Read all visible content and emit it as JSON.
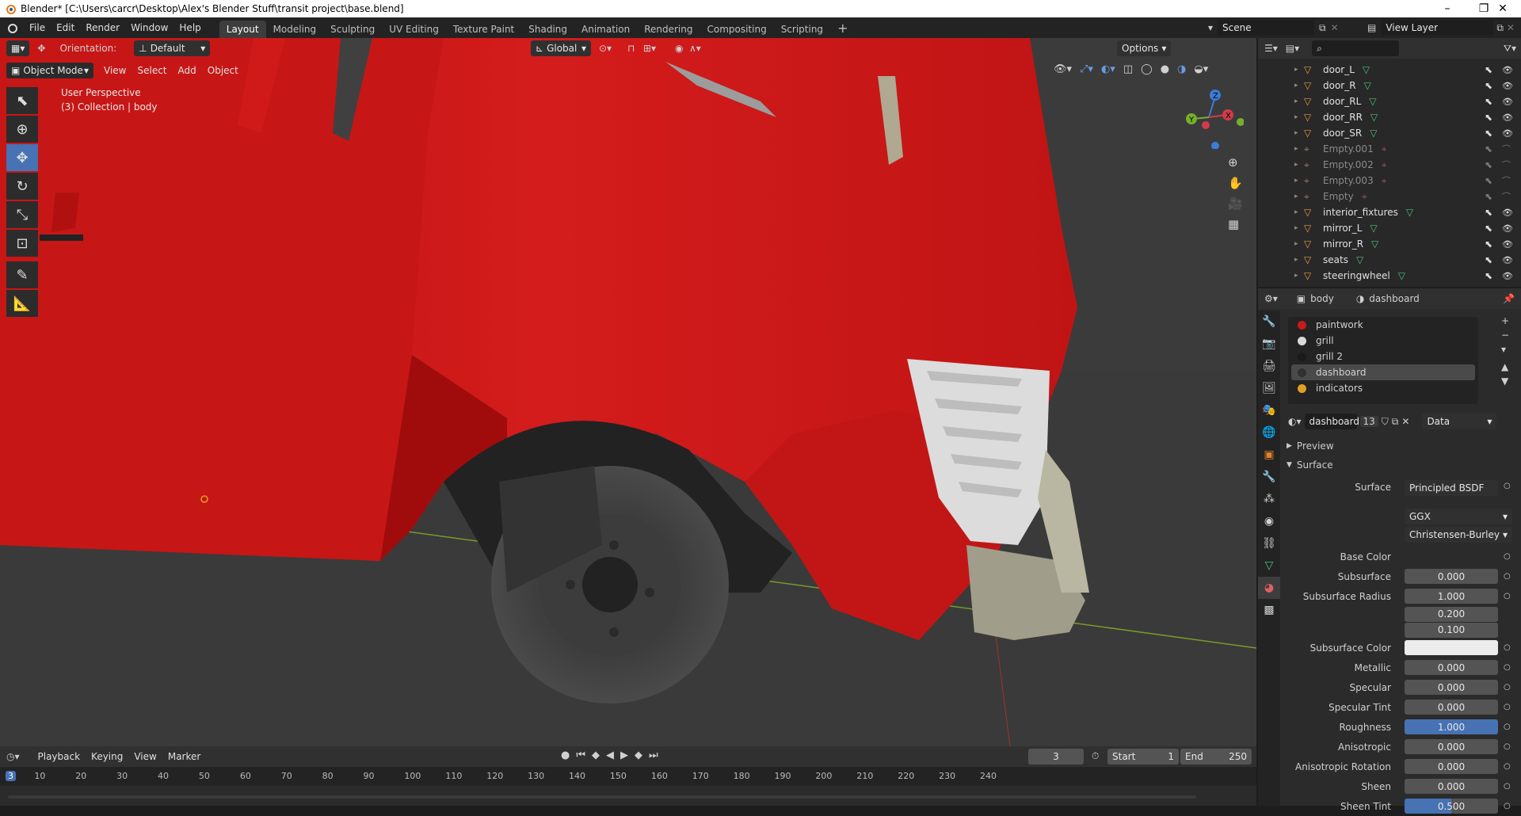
{
  "window": {
    "title": "Blender* [C:\\Users\\carcr\\Desktop\\Alex's Blender Stuff\\transit project\\base.blend]"
  },
  "menu": [
    "File",
    "Edit",
    "Render",
    "Window",
    "Help"
  ],
  "workspaces": [
    "Layout",
    "Modeling",
    "Sculpting",
    "UV Editing",
    "Texture Paint",
    "Shading",
    "Animation",
    "Rendering",
    "Compositing",
    "Scripting"
  ],
  "scene": {
    "name": "Scene",
    "view_layer": "View Layer"
  },
  "viewport": {
    "orientation_label": "Orientation:",
    "orientation_value": "Default",
    "transform": "Global",
    "options": "Options",
    "mode": "Object Mode",
    "menus": [
      "View",
      "Select",
      "Add",
      "Object"
    ],
    "info_line1": "User Perspective",
    "info_line2": "(3) Collection | body"
  },
  "outliner": {
    "items": [
      {
        "name": "door_L",
        "dim": false
      },
      {
        "name": "door_R",
        "dim": false
      },
      {
        "name": "door_RL",
        "dim": false
      },
      {
        "name": "door_RR",
        "dim": false
      },
      {
        "name": "door_SR",
        "dim": false
      },
      {
        "name": "Empty.001",
        "dim": true
      },
      {
        "name": "Empty.002",
        "dim": true
      },
      {
        "name": "Empty.003",
        "dim": true
      },
      {
        "name": "Empty",
        "dim": true
      },
      {
        "name": "interior_fixtures",
        "dim": false
      },
      {
        "name": "mirror_L",
        "dim": false
      },
      {
        "name": "mirror_R",
        "dim": false
      },
      {
        "name": "seats",
        "dim": false
      },
      {
        "name": "steeringwheel",
        "dim": false
      }
    ]
  },
  "properties": {
    "breadcrumb_object": "body",
    "breadcrumb_material": "dashboard",
    "material_slots": [
      {
        "name": "paintwork",
        "color": "#c81a1a"
      },
      {
        "name": "grill",
        "color": "#d9d9d9"
      },
      {
        "name": "grill 2",
        "color": "#1a1a1a"
      },
      {
        "name": "dashboard",
        "color": "#303030"
      },
      {
        "name": "indicators",
        "color": "#e0a020"
      }
    ],
    "active_material": "dashboard",
    "user_count": "13",
    "link": "Data",
    "panel_preview": "Preview",
    "panel_surface": "Surface",
    "surface_label": "Surface",
    "surface_value": "Principled BSDF",
    "distribution": "GGX",
    "subsurface_method": "Christensen-Burley",
    "fields": [
      {
        "label": "Base Color",
        "value": "",
        "kind": "color-none"
      },
      {
        "label": "Subsurface",
        "value": "0.000",
        "kind": "num"
      },
      {
        "label": "Subsurface Radius",
        "value": "1.000",
        "kind": "num"
      },
      {
        "label": "",
        "value": "0.200",
        "kind": "num"
      },
      {
        "label": "",
        "value": "0.100",
        "kind": "num"
      },
      {
        "label": "Subsurface Color",
        "value": "",
        "kind": "color-white"
      },
      {
        "label": "Metallic",
        "value": "0.000",
        "kind": "num"
      },
      {
        "label": "Specular",
        "value": "0.000",
        "kind": "num"
      },
      {
        "label": "Specular Tint",
        "value": "0.000",
        "kind": "num"
      },
      {
        "label": "Roughness",
        "value": "1.000",
        "kind": "num-blue"
      },
      {
        "label": "Anisotropic",
        "value": "0.000",
        "kind": "num"
      },
      {
        "label": "Anisotropic Rotation",
        "value": "0.000",
        "kind": "num"
      },
      {
        "label": "Sheen",
        "value": "0.000",
        "kind": "num"
      },
      {
        "label": "Sheen Tint",
        "value": "0.500",
        "kind": "num-half"
      }
    ]
  },
  "timeline": {
    "menus": [
      "Playback",
      "Keying",
      "View",
      "Marker"
    ],
    "current_frame": "3",
    "start_label": "Start",
    "start": "1",
    "end_label": "End",
    "end": "250",
    "ticks": [
      "3",
      "10",
      "20",
      "30",
      "40",
      "50",
      "60",
      "70",
      "80",
      "90",
      "100",
      "110",
      "120",
      "130",
      "140",
      "150",
      "160",
      "170",
      "180",
      "190",
      "200",
      "210",
      "220",
      "230",
      "240"
    ]
  },
  "colors": {
    "accent": "#4772b3",
    "body_red": "#d01818"
  }
}
